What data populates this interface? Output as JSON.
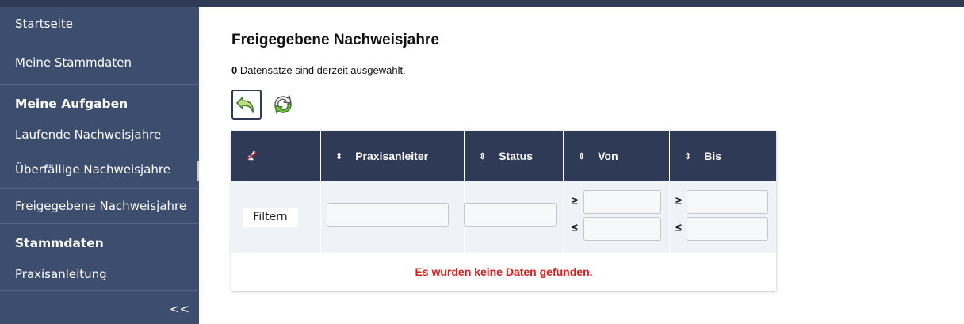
{
  "sidebar": {
    "items": [
      {
        "label": "Startseite"
      },
      {
        "label": "Meine Stammdaten"
      },
      {
        "label": "Laufende Nachweisjahre"
      },
      {
        "label": "Überfällige Nachweisjahre"
      },
      {
        "label": "Freigegebene Nachweisjahre"
      },
      {
        "label": "Praxisanleitung"
      }
    ],
    "sections": [
      "Meine Aufgaben",
      "Stammdaten"
    ],
    "collapse_label": "<<"
  },
  "main": {
    "title": "Freigegebene Nachweisjahre",
    "selection_count": "0",
    "selection_text": " Datensätze sind derzeit ausgewählt.",
    "toolbar": {
      "back_icon": "undo-arrow-icon",
      "refresh_icon": "refresh-icon"
    },
    "table": {
      "columns": [
        "Praxisanleiter",
        "Status",
        "Von",
        "Bis"
      ],
      "sort_glyph": "⇕",
      "filter_button": "Filtern",
      "ge": "≥",
      "le": "≤",
      "empty_message": "Es wurden keine Daten gefunden."
    }
  },
  "colors": {
    "sidebar": "#3c4d6e",
    "header": "#2e3a56",
    "error": "#e01919"
  }
}
